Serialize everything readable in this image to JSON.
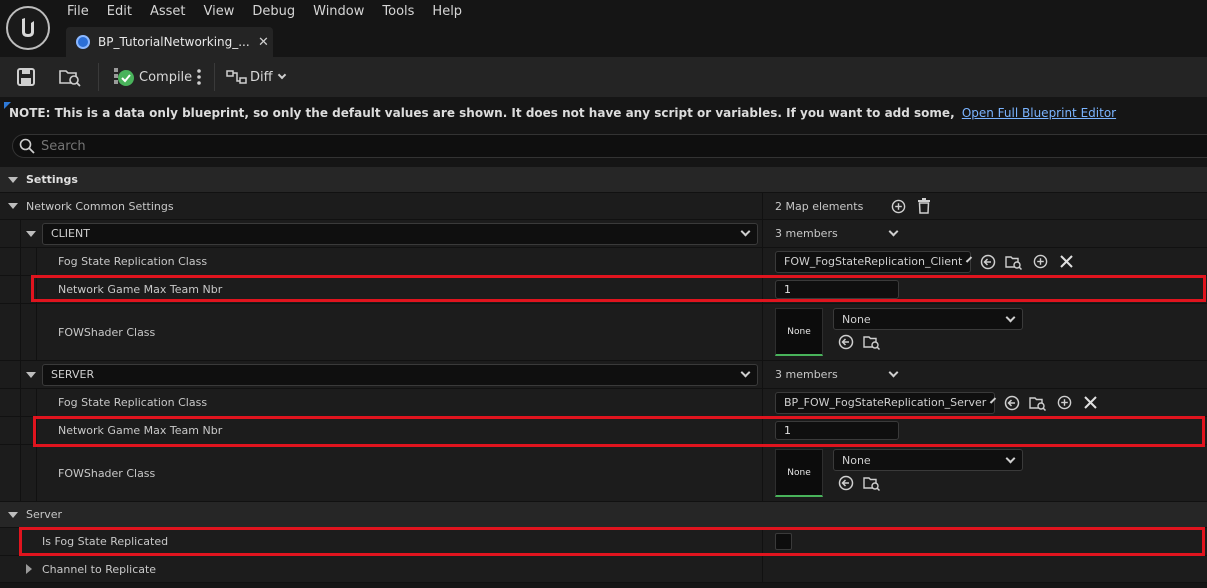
{
  "menu": [
    "File",
    "Edit",
    "Asset",
    "View",
    "Debug",
    "Window",
    "Tools",
    "Help"
  ],
  "tab": {
    "title": "BP_TutorialNetworking_...",
    "close": "✕"
  },
  "toolbar": {
    "compile_label": "Compile",
    "diff_label": "Diff"
  },
  "notice": {
    "text": "NOTE: This is a data only blueprint, so only the default values are shown.  It does not have any script or variables.  If you want to add some,",
    "link": "Open Full Blueprint Editor"
  },
  "search": {
    "placeholder": "Search"
  },
  "settings": {
    "category": "Settings",
    "network_common": {
      "label": "Network Common Settings",
      "value": "2 Map elements"
    },
    "client": {
      "key": "CLIENT",
      "members": "3 members",
      "fog_label": "Fog State Replication Class",
      "fog_value": "FOW_FogStateReplication_Client",
      "team_label": "Network Game Max Team Nbr",
      "team_value": "1",
      "shader_label": "FOWShader Class",
      "shader_thumb": "None",
      "shader_value": "None"
    },
    "server_entry": {
      "key": "SERVER",
      "members": "3 members",
      "fog_label": "Fog State Replication Class",
      "fog_value": "BP_FOW_FogStateReplication_Server",
      "team_label": "Network Game Max Team Nbr",
      "team_value": "1",
      "shader_label": "FOWShader Class",
      "shader_thumb": "None",
      "shader_value": "None"
    }
  },
  "server": {
    "category": "Server",
    "replicated_label": "Is Fog State Replicated",
    "channel_label": "Channel to Replicate"
  },
  "colors": {
    "highlight": "#e0141e",
    "link": "#7ab4ff",
    "accent": "#2e7ad8",
    "compile_ok": "#49b35b"
  }
}
